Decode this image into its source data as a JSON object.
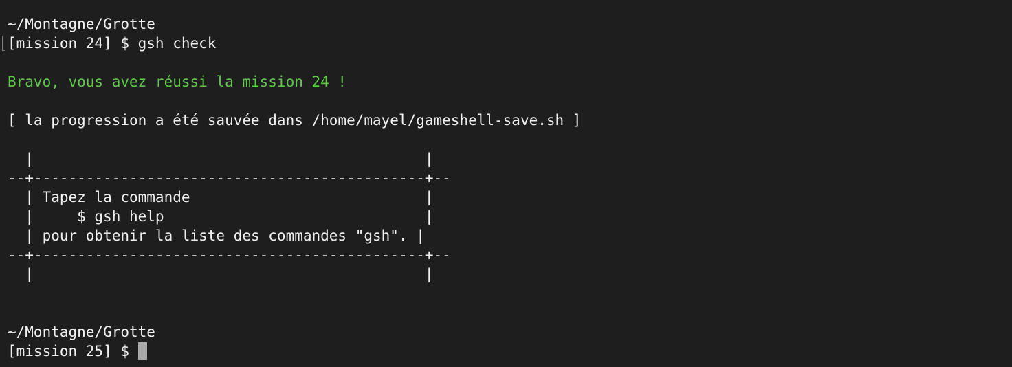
{
  "terminal": {
    "lines": [
      "~/Montagne/Grotte",
      "[mission 24] $ gsh check",
      "",
      "Bravo, vous avez réussi la mission 24 !",
      "",
      "[ la progression a été sauvée dans /home/mayel/gameshell-save.sh ]",
      "",
      "  |                                             |",
      "--+---------------------------------------------+--",
      "  | Tapez la commande                           |",
      "  |     $ gsh help                              |",
      "  | pour obtenir la liste des commandes \"gsh\". |",
      "--+---------------------------------------------+--",
      "  |                                             |",
      "",
      "",
      "~/Montagne/Grotte",
      "[mission 25] $ "
    ]
  },
  "colors": {
    "background": "#1e1e1e",
    "text": "#f0f0f0",
    "success": "#5fca49",
    "cursor": "#a8a8a8"
  }
}
